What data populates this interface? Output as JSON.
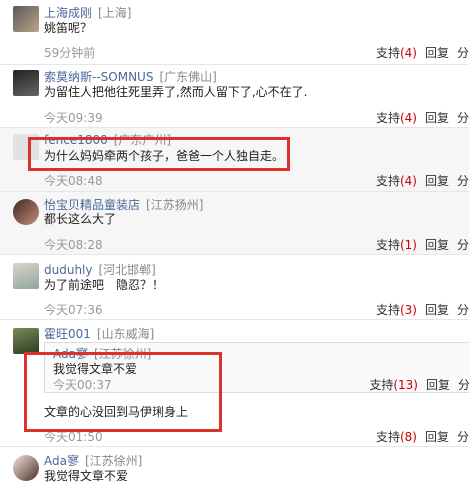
{
  "comments": [
    {
      "user": "上海成刚",
      "location": "[上海]",
      "text": "姚笛呢？",
      "time": "59分钟前",
      "support": "支持",
      "support_count": "(4)",
      "reply": "回复",
      "share": "分"
    },
    {
      "user": "索莫纳斯--SOMNUS",
      "location": "[广东佛山]",
      "text": "为留住人把他往死里弄了,然而人留下了,心不在了.",
      "time": "今天09:39",
      "support": "支持",
      "support_count": "(4)",
      "reply": "回复",
      "share": "分"
    },
    {
      "user": "fence1800",
      "location": "[广东广州]",
      "text": "为什么妈妈牵两个孩子，爸爸一个人独自走。",
      "time": "今天08:48",
      "support": "支持",
      "support_count": "(4)",
      "reply": "回复",
      "share": "分"
    },
    {
      "user": "怡宝贝精品童装店",
      "location": "[江苏扬州]",
      "text": "都长这么大了",
      "time": "今天08:28",
      "support": "支持",
      "support_count": "(1)",
      "reply": "回复",
      "share": "分"
    },
    {
      "user": "duduhly",
      "location": "[河北邯郸]",
      "text": "为了前途吧　隐忍？！",
      "time": "今天07:36",
      "support": "支持",
      "support_count": "(3)",
      "reply": "回复",
      "share": "分"
    },
    {
      "user": "霍旺001",
      "location": "[山东威海]",
      "text": "文章的心没回到马伊琍身上",
      "time": "今天01:50",
      "support": "支持",
      "support_count": "(8)",
      "reply": "回复",
      "share": "分",
      "quote": {
        "user": "Ada寥",
        "location": "[江苏徐州]",
        "text": "我觉得文章不爱",
        "time": "今天00:37",
        "support": "支持",
        "support_count": "(13)",
        "reply": "回复",
        "share": "分"
      }
    },
    {
      "user": "Ada寥",
      "location": "[江苏徐州]",
      "text": "我觉得文章不爱"
    }
  ]
}
